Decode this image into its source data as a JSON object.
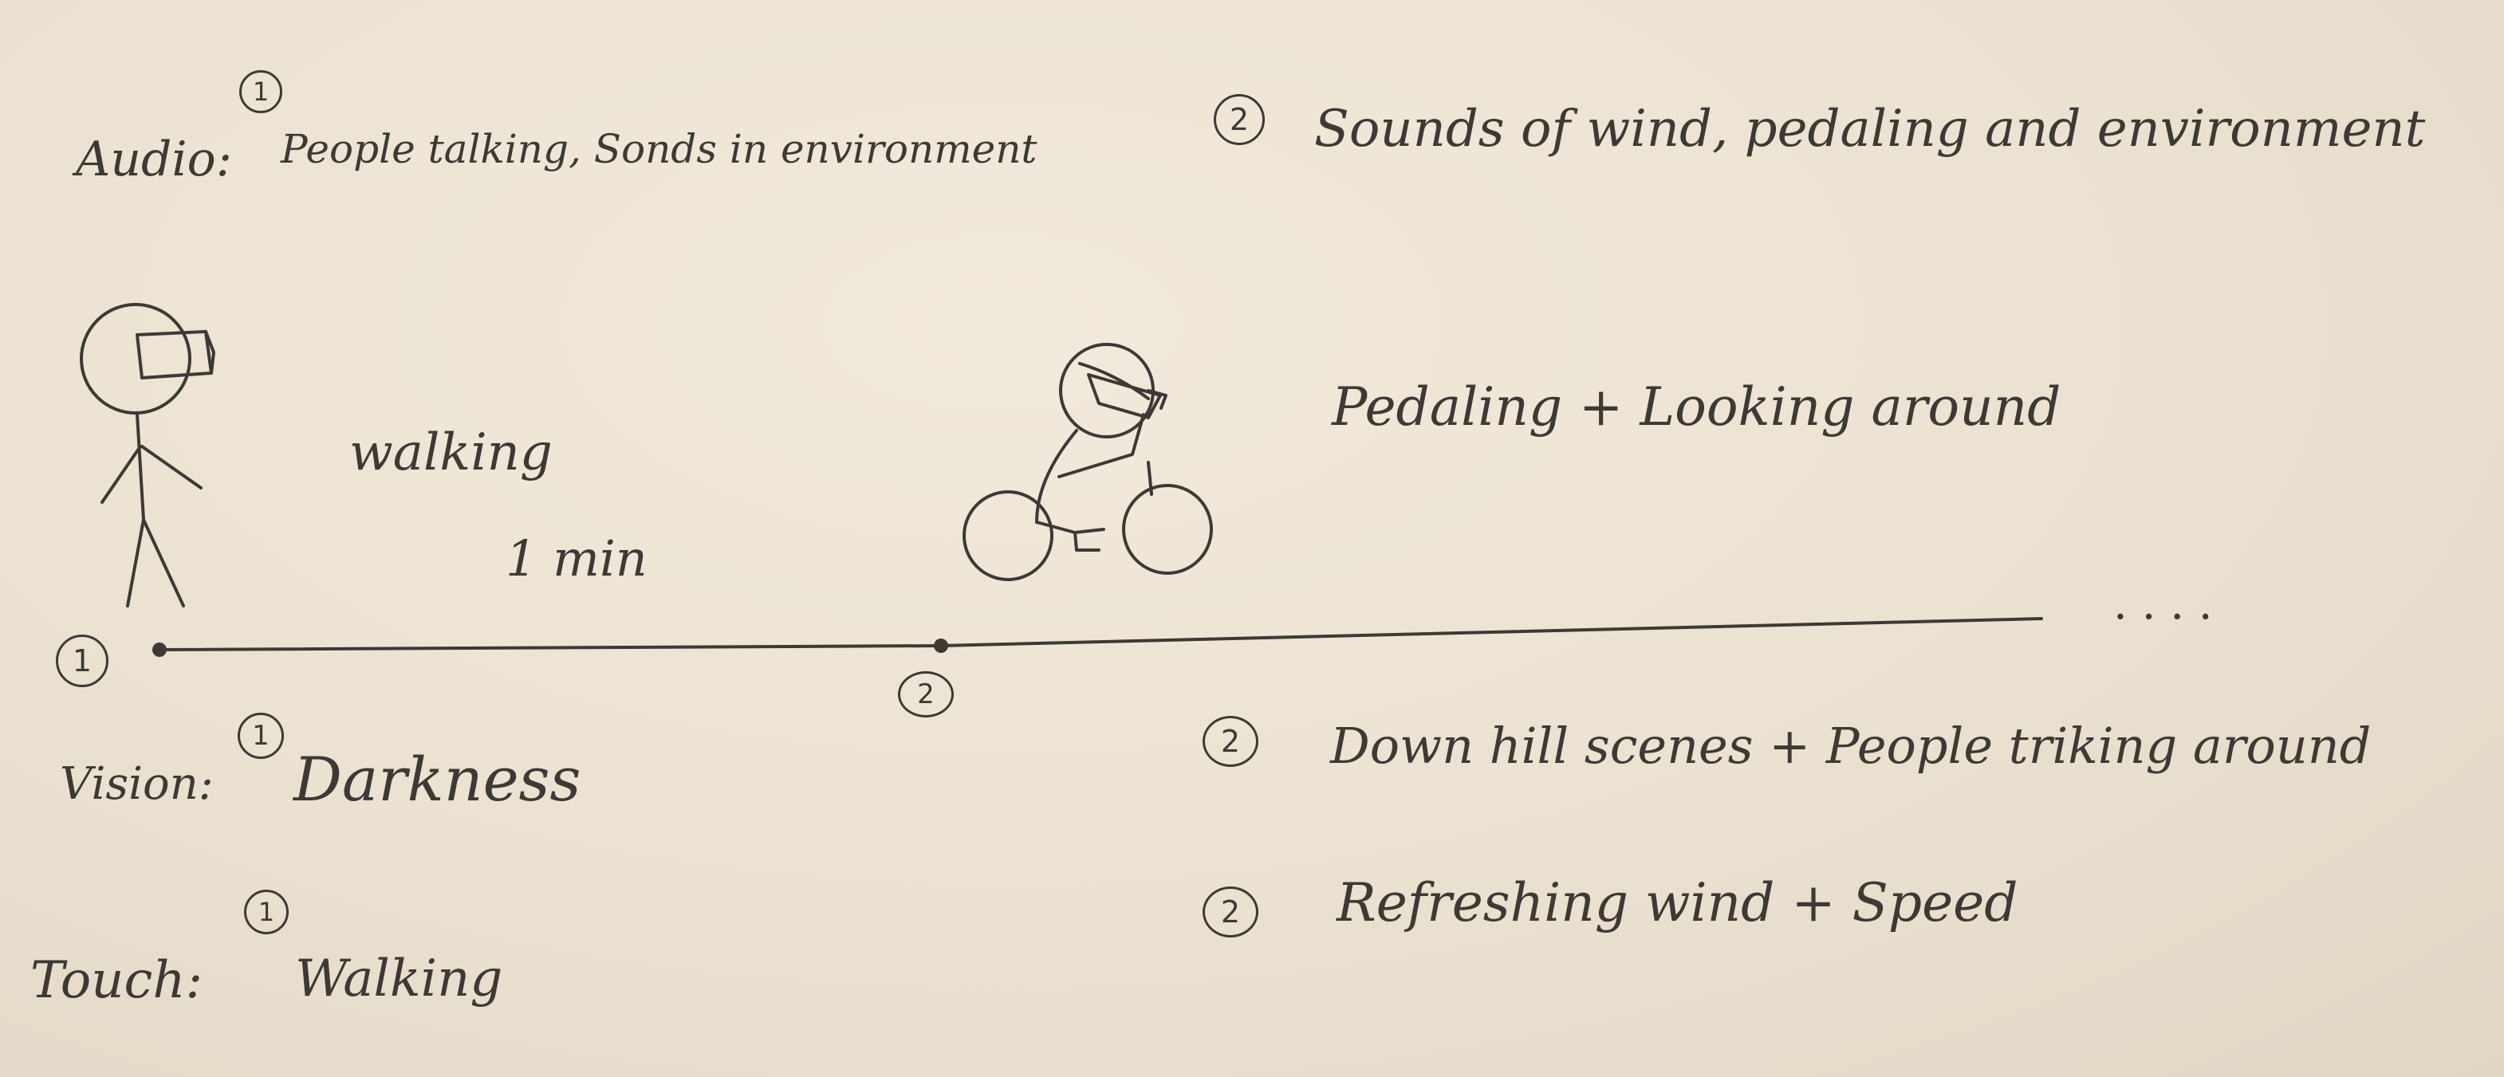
{
  "audio": {
    "label": "Audio:",
    "stage1_marker": "1",
    "stage1_text": "People talking, Sonds in environment",
    "stage2_marker": "2",
    "stage2_text": "Sounds of wind, pedaling and environment"
  },
  "timeline": {
    "start_marker": "1",
    "mid_marker": "2",
    "walk_action": "walking",
    "walk_duration": "1 min",
    "bike_action": "Pedaling + Looking around",
    "continuation": ". . . ."
  },
  "vision": {
    "label": "Vision:",
    "stage1_marker": "1",
    "stage1_text": "Darkness",
    "stage2_marker": "2",
    "stage2_text": "Down hill scenes + People triking around"
  },
  "touch": {
    "label": "Touch:",
    "stage1_marker": "1",
    "stage1_text": "Walking",
    "stage2_marker": "2",
    "stage2_text": "Refreshing wind + Speed"
  },
  "colors": {
    "paper": "#ece2d3",
    "ink": "#3d3935"
  },
  "icons": [
    "vr-headset-walker-icon",
    "vr-headset-cyclist-icon"
  ]
}
